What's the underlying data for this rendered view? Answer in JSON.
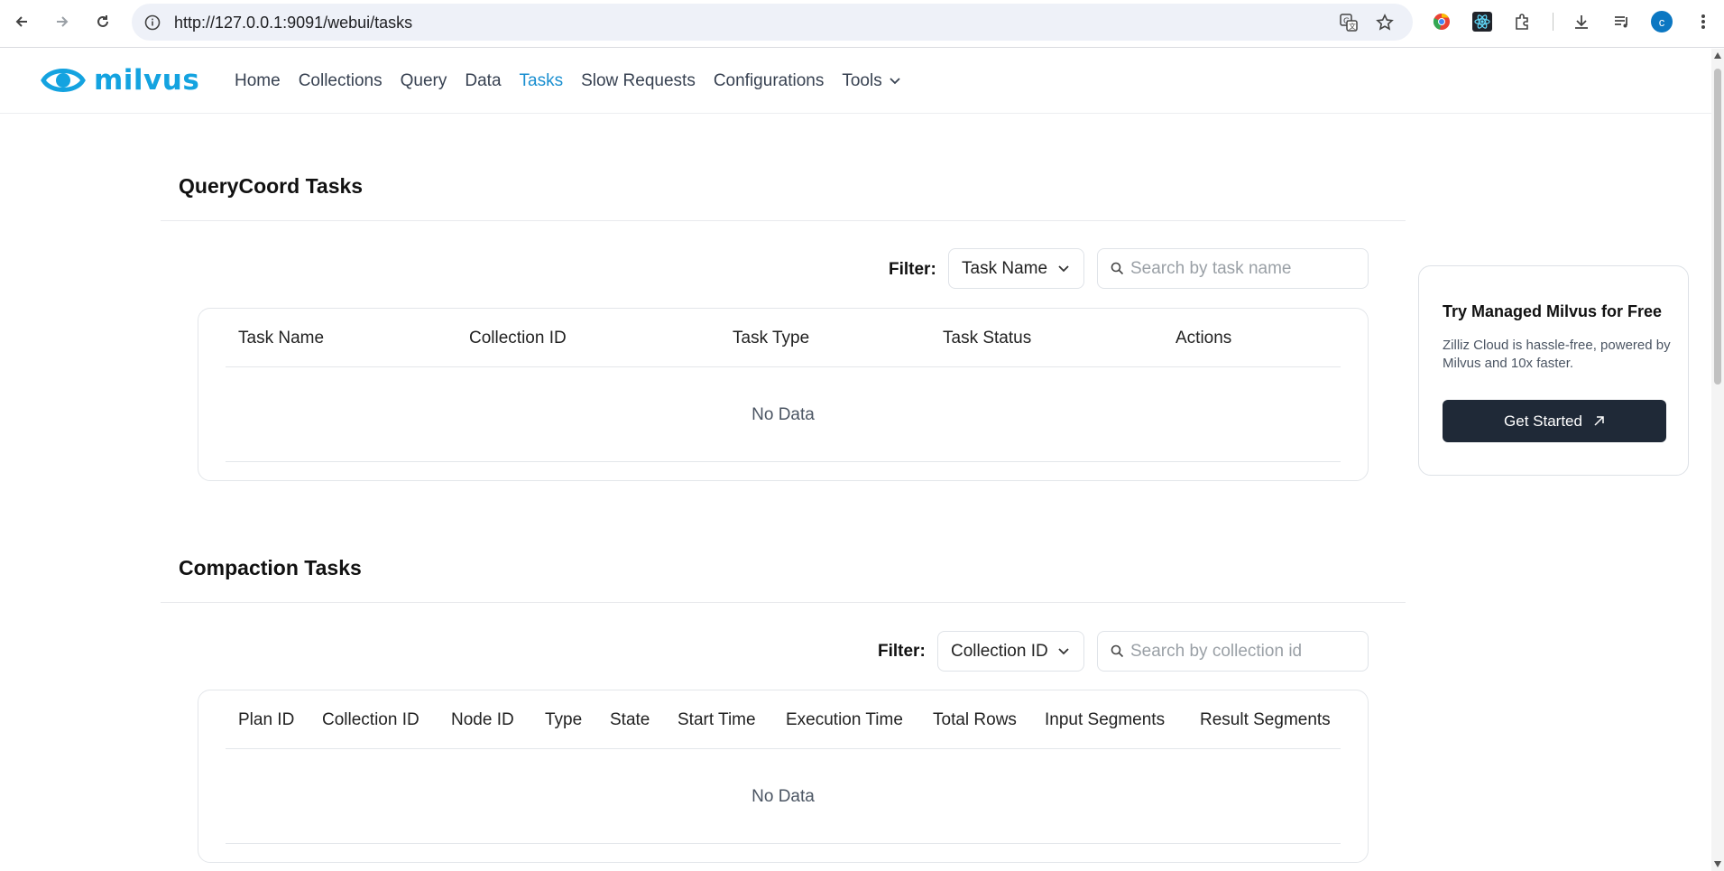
{
  "browser": {
    "url": "http://127.0.0.1:9091/webui/tasks",
    "profile_initial": "c"
  },
  "app": {
    "logo_text": "milvus",
    "brand_color": "#14a3e0",
    "nav": [
      {
        "label": "Home"
      },
      {
        "label": "Collections"
      },
      {
        "label": "Query"
      },
      {
        "label": "Data"
      },
      {
        "label": "Tasks",
        "active": true
      },
      {
        "label": "Slow Requests"
      },
      {
        "label": "Configurations"
      },
      {
        "label": "Tools"
      }
    ]
  },
  "querycoord": {
    "title": "QueryCoord Tasks",
    "filter_label": "Filter:",
    "filter_select": "Task Name",
    "search_placeholder": "Search by task name",
    "columns": [
      "Task Name",
      "Collection ID",
      "Task Type",
      "Task Status",
      "Actions"
    ],
    "empty_text": "No Data"
  },
  "compaction": {
    "title": "Compaction Tasks",
    "filter_label": "Filter:",
    "filter_select": "Collection ID",
    "search_placeholder": "Search by collection id",
    "columns": [
      "Plan ID",
      "Collection ID",
      "Node ID",
      "Type",
      "State",
      "Start Time",
      "Execution Time",
      "Total Rows",
      "Input Segments",
      "Result Segments"
    ],
    "empty_text": "No Data"
  },
  "promo": {
    "title": "Try Managed Milvus for Free",
    "description": "Zilliz Cloud is hassle-free, powered by Milvus and 10x faster.",
    "button_label": "Get Started"
  }
}
